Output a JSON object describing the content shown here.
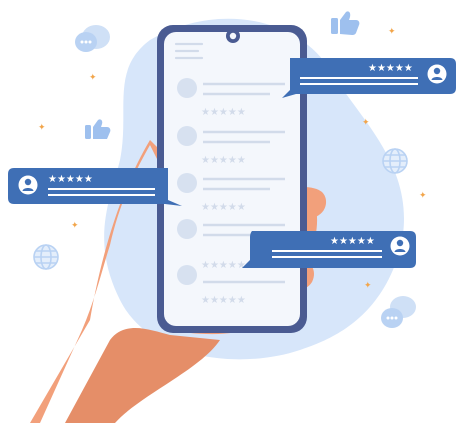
{
  "colors": {
    "primary_blue": "#3f6fb5",
    "light_blue": "#d7e6fa",
    "star_orange": "#f2a54a",
    "phone_frame": "#4a5b92",
    "skin": "#f2a07b"
  },
  "reviews": {
    "phone_rating_glyphs": "★★★★★",
    "bubble_top_right_stars": "★★★★★",
    "bubble_left_stars": "★★★★★",
    "bubble_bottom_right_stars": "★★★★★"
  },
  "icons": [
    "chat-bubble-icon",
    "thumbs-up-icon",
    "globe-icon",
    "user-avatar-icon",
    "star-icon"
  ]
}
